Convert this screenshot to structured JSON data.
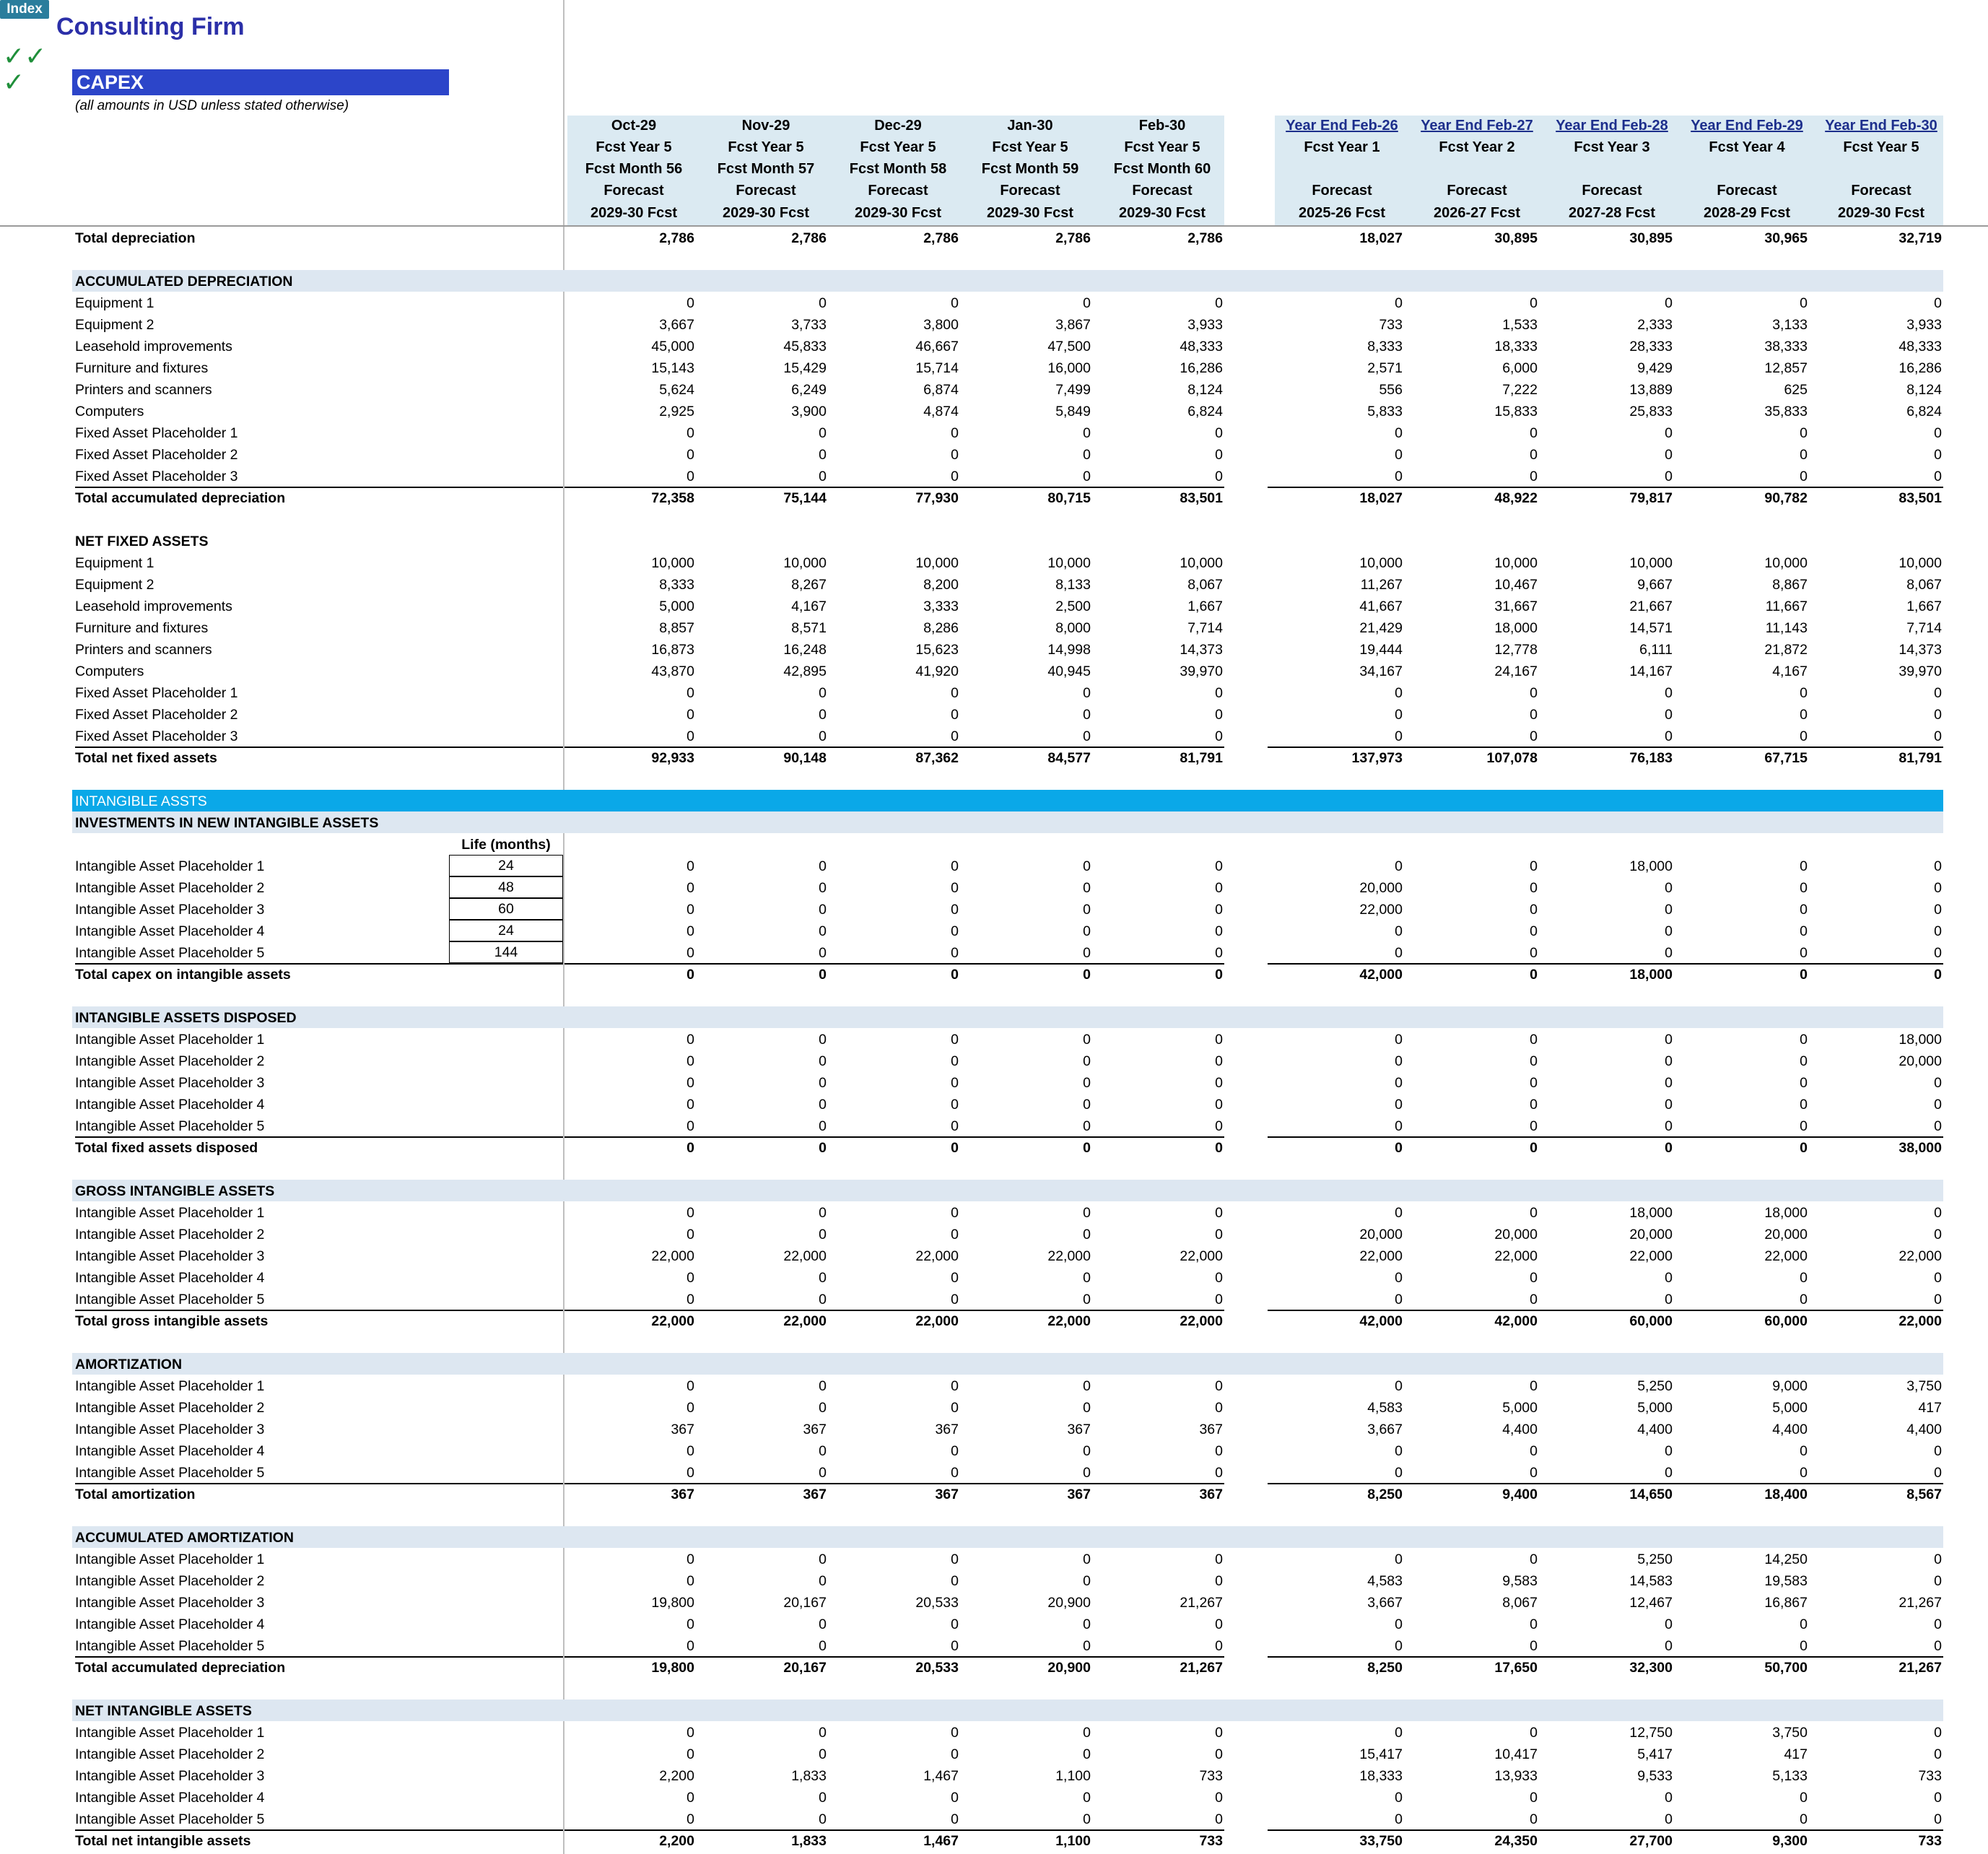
{
  "header": {
    "index_button": "Index",
    "company": "Consulting Firm",
    "checkmarks": "✓✓\n✓",
    "sheet_title": "CAPEX",
    "subtitle": "(all amounts in USD unless stated otherwise)"
  },
  "monthly_columns": [
    {
      "period": "Oct-29",
      "year": "Fcst Year 5",
      "month": "Fcst Month 56",
      "type": "Forecast",
      "fy": "2029-30 Fcst"
    },
    {
      "period": "Nov-29",
      "year": "Fcst Year 5",
      "month": "Fcst Month 57",
      "type": "Forecast",
      "fy": "2029-30 Fcst"
    },
    {
      "period": "Dec-29",
      "year": "Fcst Year 5",
      "month": "Fcst Month 58",
      "type": "Forecast",
      "fy": "2029-30 Fcst"
    },
    {
      "period": "Jan-30",
      "year": "Fcst Year 5",
      "month": "Fcst Month 59",
      "type": "Forecast",
      "fy": "2029-30 Fcst"
    },
    {
      "period": "Feb-30",
      "year": "Fcst Year 5",
      "month": "Fcst Month 60",
      "type": "Forecast",
      "fy": "2029-30 Fcst"
    }
  ],
  "annual_columns": [
    {
      "period": "Year End  Feb-26",
      "year": "Fcst Year 1",
      "type": "Forecast",
      "fy": "2025-26 Fcst"
    },
    {
      "period": "Year End  Feb-27",
      "year": "Fcst Year 2",
      "type": "Forecast",
      "fy": "2026-27 Fcst"
    },
    {
      "period": "Year End  Feb-28",
      "year": "Fcst Year 3",
      "type": "Forecast",
      "fy": "2027-28 Fcst"
    },
    {
      "period": "Year End  Feb-29",
      "year": "Fcst Year 4",
      "type": "Forecast",
      "fy": "2028-29 Fcst"
    },
    {
      "period": "Year End  Feb-30",
      "year": "Fcst Year 5",
      "type": "Forecast",
      "fy": "2029-30 Fcst"
    }
  ],
  "top_total": {
    "label": "Total depreciation",
    "values": [
      "2,786",
      "2,786",
      "2,786",
      "2,786",
      "2,786",
      "18,027",
      "30,895",
      "30,895",
      "30,965",
      "32,719"
    ]
  },
  "intangible_banner": "INTANGIBLE ASSTS",
  "life_header": "Life (months)",
  "sections": [
    {
      "title": "ACCUMULATED DEPRECIATION",
      "shaded": true,
      "rows": [
        {
          "label": "Equipment 1",
          "values": [
            "0",
            "0",
            "0",
            "0",
            "0",
            "0",
            "0",
            "0",
            "0",
            "0"
          ]
        },
        {
          "label": "Equipment 2",
          "values": [
            "3,667",
            "3,733",
            "3,800",
            "3,867",
            "3,933",
            "733",
            "1,533",
            "2,333",
            "3,133",
            "3,933"
          ]
        },
        {
          "label": "Leasehold improvements",
          "values": [
            "45,000",
            "45,833",
            "46,667",
            "47,500",
            "48,333",
            "8,333",
            "18,333",
            "28,333",
            "38,333",
            "48,333"
          ]
        },
        {
          "label": "Furniture and fixtures",
          "values": [
            "15,143",
            "15,429",
            "15,714",
            "16,000",
            "16,286",
            "2,571",
            "6,000",
            "9,429",
            "12,857",
            "16,286"
          ]
        },
        {
          "label": "Printers and scanners",
          "values": [
            "5,624",
            "6,249",
            "6,874",
            "7,499",
            "8,124",
            "556",
            "7,222",
            "13,889",
            "625",
            "8,124"
          ]
        },
        {
          "label": "Computers",
          "values": [
            "2,925",
            "3,900",
            "4,874",
            "5,849",
            "6,824",
            "5,833",
            "15,833",
            "25,833",
            "35,833",
            "6,824"
          ]
        },
        {
          "label": "Fixed Asset Placeholder 1",
          "values": [
            "0",
            "0",
            "0",
            "0",
            "0",
            "0",
            "0",
            "0",
            "0",
            "0"
          ]
        },
        {
          "label": "Fixed Asset Placeholder 2",
          "values": [
            "0",
            "0",
            "0",
            "0",
            "0",
            "0",
            "0",
            "0",
            "0",
            "0"
          ]
        },
        {
          "label": "Fixed Asset Placeholder 3",
          "values": [
            "0",
            "0",
            "0",
            "0",
            "0",
            "0",
            "0",
            "0",
            "0",
            "0"
          ]
        }
      ],
      "total": {
        "label": "Total accumulated depreciation",
        "values": [
          "72,358",
          "75,144",
          "77,930",
          "80,715",
          "83,501",
          "18,027",
          "48,922",
          "79,817",
          "90,782",
          "83,501"
        ]
      }
    },
    {
      "title": "NET FIXED ASSETS",
      "shaded": false,
      "rows": [
        {
          "label": "Equipment 1",
          "values": [
            "10,000",
            "10,000",
            "10,000",
            "10,000",
            "10,000",
            "10,000",
            "10,000",
            "10,000",
            "10,000",
            "10,000"
          ]
        },
        {
          "label": "Equipment 2",
          "values": [
            "8,333",
            "8,267",
            "8,200",
            "8,133",
            "8,067",
            "11,267",
            "10,467",
            "9,667",
            "8,867",
            "8,067"
          ]
        },
        {
          "label": "Leasehold improvements",
          "values": [
            "5,000",
            "4,167",
            "3,333",
            "2,500",
            "1,667",
            "41,667",
            "31,667",
            "21,667",
            "11,667",
            "1,667"
          ]
        },
        {
          "label": "Furniture and fixtures",
          "values": [
            "8,857",
            "8,571",
            "8,286",
            "8,000",
            "7,714",
            "21,429",
            "18,000",
            "14,571",
            "11,143",
            "7,714"
          ]
        },
        {
          "label": "Printers and scanners",
          "values": [
            "16,873",
            "16,248",
            "15,623",
            "14,998",
            "14,373",
            "19,444",
            "12,778",
            "6,111",
            "21,872",
            "14,373"
          ]
        },
        {
          "label": "Computers",
          "values": [
            "43,870",
            "42,895",
            "41,920",
            "40,945",
            "39,970",
            "34,167",
            "24,167",
            "14,167",
            "4,167",
            "39,970"
          ]
        },
        {
          "label": "Fixed Asset Placeholder 1",
          "values": [
            "0",
            "0",
            "0",
            "0",
            "0",
            "0",
            "0",
            "0",
            "0",
            "0"
          ]
        },
        {
          "label": "Fixed Asset Placeholder 2",
          "values": [
            "0",
            "0",
            "0",
            "0",
            "0",
            "0",
            "0",
            "0",
            "0",
            "0"
          ]
        },
        {
          "label": "Fixed Asset Placeholder 3",
          "values": [
            "0",
            "0",
            "0",
            "0",
            "0",
            "0",
            "0",
            "0",
            "0",
            "0"
          ]
        }
      ],
      "total": {
        "label": "Total net fixed assets",
        "values": [
          "92,933",
          "90,148",
          "87,362",
          "84,577",
          "81,791",
          "137,973",
          "107,078",
          "76,183",
          "67,715",
          "81,791"
        ]
      }
    },
    {
      "title": "INVESTMENTS IN NEW INTANGIBLE ASSETS",
      "shaded": true,
      "has_life": true,
      "rows": [
        {
          "label": "Intangible Asset Placeholder 1",
          "life": "24",
          "values": [
            "0",
            "0",
            "0",
            "0",
            "0",
            "0",
            "0",
            "18,000",
            "0",
            "0"
          ]
        },
        {
          "label": "Intangible Asset Placeholder 2",
          "life": "48",
          "values": [
            "0",
            "0",
            "0",
            "0",
            "0",
            "20,000",
            "0",
            "0",
            "0",
            "0"
          ]
        },
        {
          "label": "Intangible Asset Placeholder 3",
          "life": "60",
          "values": [
            "0",
            "0",
            "0",
            "0",
            "0",
            "22,000",
            "0",
            "0",
            "0",
            "0"
          ]
        },
        {
          "label": "Intangible Asset Placeholder 4",
          "life": "24",
          "values": [
            "0",
            "0",
            "0",
            "0",
            "0",
            "0",
            "0",
            "0",
            "0",
            "0"
          ]
        },
        {
          "label": "Intangible Asset Placeholder 5",
          "life": "144",
          "values": [
            "0",
            "0",
            "0",
            "0",
            "0",
            "0",
            "0",
            "0",
            "0",
            "0"
          ]
        }
      ],
      "total": {
        "label": "Total capex on intangible assets",
        "values": [
          "0",
          "0",
          "0",
          "0",
          "0",
          "42,000",
          "0",
          "18,000",
          "0",
          "0"
        ]
      }
    },
    {
      "title": "INTANGIBLE ASSETS DISPOSED",
      "shaded": true,
      "rows": [
        {
          "label": "Intangible Asset Placeholder 1",
          "values": [
            "0",
            "0",
            "0",
            "0",
            "0",
            "0",
            "0",
            "0",
            "0",
            "18,000"
          ]
        },
        {
          "label": "Intangible Asset Placeholder 2",
          "values": [
            "0",
            "0",
            "0",
            "0",
            "0",
            "0",
            "0",
            "0",
            "0",
            "20,000"
          ]
        },
        {
          "label": "Intangible Asset Placeholder 3",
          "values": [
            "0",
            "0",
            "0",
            "0",
            "0",
            "0",
            "0",
            "0",
            "0",
            "0"
          ]
        },
        {
          "label": "Intangible Asset Placeholder 4",
          "values": [
            "0",
            "0",
            "0",
            "0",
            "0",
            "0",
            "0",
            "0",
            "0",
            "0"
          ]
        },
        {
          "label": "Intangible Asset Placeholder 5",
          "values": [
            "0",
            "0",
            "0",
            "0",
            "0",
            "0",
            "0",
            "0",
            "0",
            "0"
          ]
        }
      ],
      "total": {
        "label": "Total fixed assets disposed",
        "values": [
          "0",
          "0",
          "0",
          "0",
          "0",
          "0",
          "0",
          "0",
          "0",
          "38,000"
        ]
      }
    },
    {
      "title": "GROSS INTANGIBLE ASSETS",
      "shaded": true,
      "rows": [
        {
          "label": "Intangible Asset Placeholder 1",
          "values": [
            "0",
            "0",
            "0",
            "0",
            "0",
            "0",
            "0",
            "18,000",
            "18,000",
            "0"
          ]
        },
        {
          "label": "Intangible Asset Placeholder 2",
          "values": [
            "0",
            "0",
            "0",
            "0",
            "0",
            "20,000",
            "20,000",
            "20,000",
            "20,000",
            "0"
          ]
        },
        {
          "label": "Intangible Asset Placeholder 3",
          "values": [
            "22,000",
            "22,000",
            "22,000",
            "22,000",
            "22,000",
            "22,000",
            "22,000",
            "22,000",
            "22,000",
            "22,000"
          ]
        },
        {
          "label": "Intangible Asset Placeholder 4",
          "values": [
            "0",
            "0",
            "0",
            "0",
            "0",
            "0",
            "0",
            "0",
            "0",
            "0"
          ]
        },
        {
          "label": "Intangible Asset Placeholder 5",
          "values": [
            "0",
            "0",
            "0",
            "0",
            "0",
            "0",
            "0",
            "0",
            "0",
            "0"
          ]
        }
      ],
      "total": {
        "label": "Total gross intangible assets",
        "values": [
          "22,000",
          "22,000",
          "22,000",
          "22,000",
          "22,000",
          "42,000",
          "42,000",
          "60,000",
          "60,000",
          "22,000"
        ]
      }
    },
    {
      "title": "AMORTIZATION",
      "shaded": true,
      "rows": [
        {
          "label": "Intangible Asset Placeholder 1",
          "values": [
            "0",
            "0",
            "0",
            "0",
            "0",
            "0",
            "0",
            "5,250",
            "9,000",
            "3,750"
          ]
        },
        {
          "label": "Intangible Asset Placeholder 2",
          "values": [
            "0",
            "0",
            "0",
            "0",
            "0",
            "4,583",
            "5,000",
            "5,000",
            "5,000",
            "417"
          ]
        },
        {
          "label": "Intangible Asset Placeholder 3",
          "values": [
            "367",
            "367",
            "367",
            "367",
            "367",
            "3,667",
            "4,400",
            "4,400",
            "4,400",
            "4,400"
          ]
        },
        {
          "label": "Intangible Asset Placeholder 4",
          "values": [
            "0",
            "0",
            "0",
            "0",
            "0",
            "0",
            "0",
            "0",
            "0",
            "0"
          ]
        },
        {
          "label": "Intangible Asset Placeholder 5",
          "values": [
            "0",
            "0",
            "0",
            "0",
            "0",
            "0",
            "0",
            "0",
            "0",
            "0"
          ]
        }
      ],
      "total": {
        "label": "Total amortization",
        "values": [
          "367",
          "367",
          "367",
          "367",
          "367",
          "8,250",
          "9,400",
          "14,650",
          "18,400",
          "8,567"
        ]
      }
    },
    {
      "title": "ACCUMULATED AMORTIZATION",
      "shaded": true,
      "rows": [
        {
          "label": "Intangible Asset Placeholder 1",
          "values": [
            "0",
            "0",
            "0",
            "0",
            "0",
            "0",
            "0",
            "5,250",
            "14,250",
            "0"
          ]
        },
        {
          "label": "Intangible Asset Placeholder 2",
          "values": [
            "0",
            "0",
            "0",
            "0",
            "0",
            "4,583",
            "9,583",
            "14,583",
            "19,583",
            "0"
          ]
        },
        {
          "label": "Intangible Asset Placeholder 3",
          "values": [
            "19,800",
            "20,167",
            "20,533",
            "20,900",
            "21,267",
            "3,667",
            "8,067",
            "12,467",
            "16,867",
            "21,267"
          ]
        },
        {
          "label": "Intangible Asset Placeholder 4",
          "values": [
            "0",
            "0",
            "0",
            "0",
            "0",
            "0",
            "0",
            "0",
            "0",
            "0"
          ]
        },
        {
          "label": "Intangible Asset Placeholder 5",
          "values": [
            "0",
            "0",
            "0",
            "0",
            "0",
            "0",
            "0",
            "0",
            "0",
            "0"
          ]
        }
      ],
      "total": {
        "label": "Total accumulated depreciation",
        "values": [
          "19,800",
          "20,167",
          "20,533",
          "20,900",
          "21,267",
          "8,250",
          "17,650",
          "32,300",
          "50,700",
          "21,267"
        ]
      }
    },
    {
      "title": "NET INTANGIBLE ASSETS",
      "shaded": true,
      "rows": [
        {
          "label": "Intangible Asset Placeholder 1",
          "values": [
            "0",
            "0",
            "0",
            "0",
            "0",
            "0",
            "0",
            "12,750",
            "3,750",
            "0"
          ]
        },
        {
          "label": "Intangible Asset Placeholder 2",
          "values": [
            "0",
            "0",
            "0",
            "0",
            "0",
            "15,417",
            "10,417",
            "5,417",
            "417",
            "0"
          ]
        },
        {
          "label": "Intangible Asset Placeholder 3",
          "values": [
            "2,200",
            "1,833",
            "1,467",
            "1,100",
            "733",
            "18,333",
            "13,933",
            "9,533",
            "5,133",
            "733"
          ]
        },
        {
          "label": "Intangible Asset Placeholder 4",
          "values": [
            "0",
            "0",
            "0",
            "0",
            "0",
            "0",
            "0",
            "0",
            "0",
            "0"
          ]
        },
        {
          "label": "Intangible Asset Placeholder 5",
          "values": [
            "0",
            "0",
            "0",
            "0",
            "0",
            "0",
            "0",
            "0",
            "0",
            "0"
          ]
        }
      ],
      "total": {
        "label": "Total  net intangible assets",
        "values": [
          "2,200",
          "1,833",
          "1,467",
          "1,100",
          "733",
          "33,750",
          "24,350",
          "27,700",
          "9,300",
          "733"
        ]
      }
    }
  ]
}
